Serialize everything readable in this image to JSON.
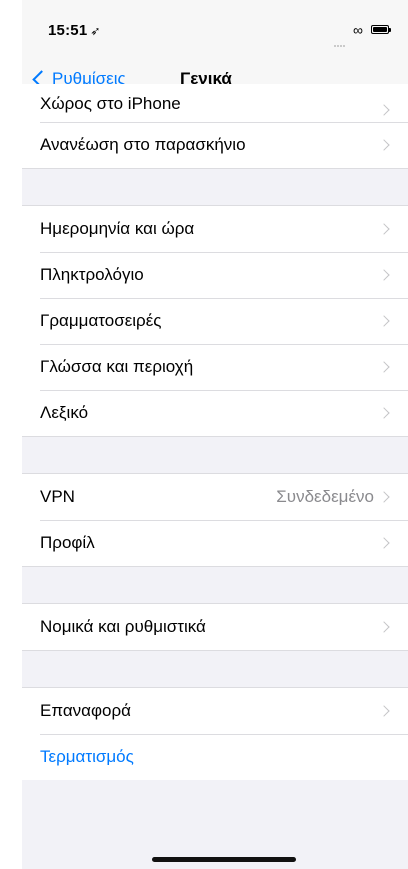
{
  "status_bar": {
    "time": "15:51",
    "location_icon": "location-arrow-icon"
  },
  "nav": {
    "back_label": "Ρυθμίσεις",
    "title": "Γενικά"
  },
  "groups": [
    {
      "rows": [
        {
          "label": "Χώρος στο iPhone"
        },
        {
          "label": "Ανανέωση στο παρασκήνιο"
        }
      ]
    },
    {
      "rows": [
        {
          "label": "Ημερομηνία και ώρα"
        },
        {
          "label": "Πληκτρολόγιο"
        },
        {
          "label": "Γραμματοσειρές"
        },
        {
          "label": "Γλώσσα και περιοχή"
        },
        {
          "label": "Λεξικό"
        }
      ]
    },
    {
      "rows": [
        {
          "label": "VPN",
          "value": "Συνδεδεμένο"
        },
        {
          "label": "Προφίλ"
        }
      ]
    },
    {
      "rows": [
        {
          "label": "Νομικά και ρυθμιστικά"
        }
      ]
    },
    {
      "rows": [
        {
          "label": "Επαναφορά"
        },
        {
          "label": "Τερματισμός"
        }
      ]
    }
  ],
  "colors": {
    "accent": "#007aff",
    "background": "#f2f2f7",
    "chevron": "#c4c4c7"
  }
}
